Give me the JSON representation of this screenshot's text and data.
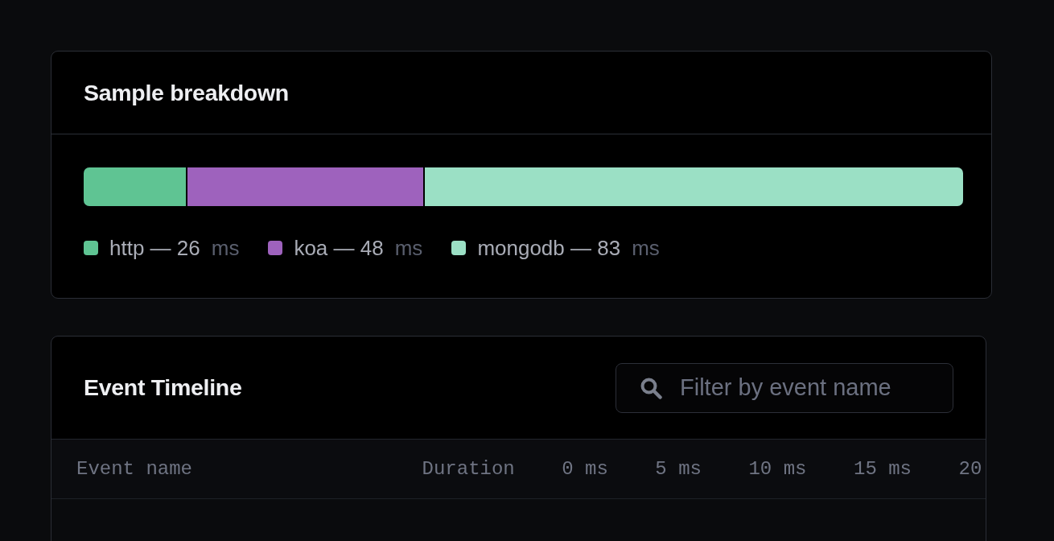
{
  "breakdown": {
    "title": "Sample breakdown",
    "segments": [
      {
        "label": "http — 26",
        "unit": "ms",
        "color": "#5fc493",
        "level": 0.116
      },
      {
        "label": "koa — 48",
        "unit": "ms",
        "color": "#9e62bd",
        "level": 0.27
      },
      {
        "label": "mongodb — 83",
        "unit": "ms",
        "color": "#9be0c5",
        "level": 0.614
      }
    ]
  },
  "timeline": {
    "title": "Event Timeline",
    "search": {
      "placeholder": "Filter by event name"
    },
    "columns": [
      "Event name",
      "Duration",
      "0 ms",
      "5 ms",
      "10 ms",
      "15 ms",
      "20"
    ]
  }
}
